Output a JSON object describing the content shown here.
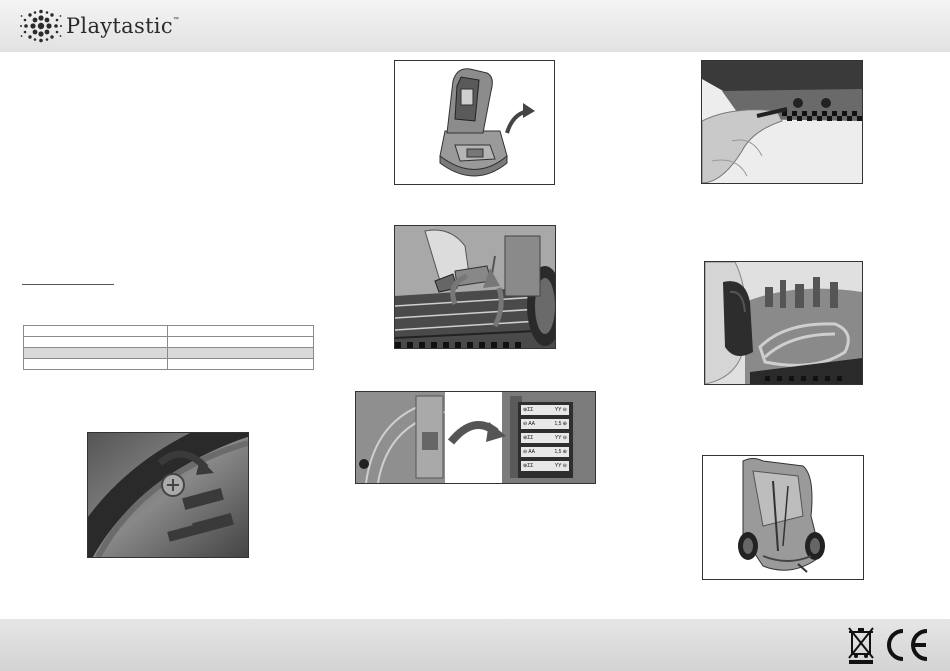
{
  "header": {
    "brand_name": "Playtastic",
    "trademark": "™"
  },
  "spec_table": {
    "rows": [
      [
        "",
        ""
      ],
      [
        "",
        ""
      ],
      [
        "",
        ""
      ],
      [
        "",
        ""
      ]
    ]
  },
  "diagrams": {
    "battery_labels": [
      {
        "left": "⊕ΣΣ",
        "right": "ΥΥ ⊖"
      },
      {
        "left": "⊖ AA",
        "right": "1,5 ⊕"
      },
      {
        "left": "⊕ΣΣ",
        "right": "ΥΥ ⊖"
      },
      {
        "left": "⊖ AA",
        "right": "1,5 ⊕"
      },
      {
        "left": "⊕ΣΣ",
        "right": "ΥΥ ⊖"
      }
    ]
  },
  "footer": {
    "certification_marks": [
      "weee-bin-icon",
      "ce-mark-icon"
    ]
  },
  "colors": {
    "header_bg": "#ebebeb",
    "footer_bg": "#dcdcdc",
    "table_shade": "#d9d9d9"
  }
}
